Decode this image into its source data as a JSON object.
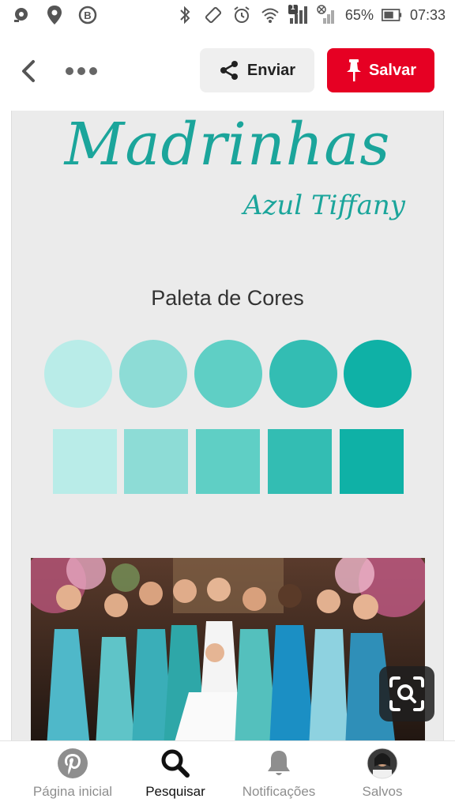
{
  "status_bar": {
    "battery": "65%",
    "time": "07:33",
    "notification_count": "1",
    "icons": [
      "app-notification-icon",
      "location-icon",
      "b-badge-icon",
      "bluetooth-icon",
      "vibrate-icon",
      "alarm-icon",
      "wifi-icon",
      "signal-icon",
      "no-signal-icon",
      "battery-icon"
    ]
  },
  "header": {
    "send_label": "Enviar",
    "save_label": "Salvar",
    "accent_color": "#e60023"
  },
  "pin": {
    "title": "Madrinhas",
    "subtitle": "Azul Tiffany",
    "palette_title": "Paleta de Cores",
    "palette_colors": [
      "#b9ece8",
      "#8ddcd6",
      "#5fcfc5",
      "#33bdb3",
      "#0fb1a6"
    ],
    "title_color": "#1ba59b"
  },
  "bottom_nav": {
    "items": [
      {
        "label": "Página inicial",
        "icon": "pinterest-logo-icon"
      },
      {
        "label": "Pesquisar",
        "icon": "search-icon"
      },
      {
        "label": "Notificações",
        "icon": "bell-icon"
      },
      {
        "label": "Salvos",
        "icon": "profile-avatar"
      }
    ],
    "active": "Pesquisar"
  }
}
